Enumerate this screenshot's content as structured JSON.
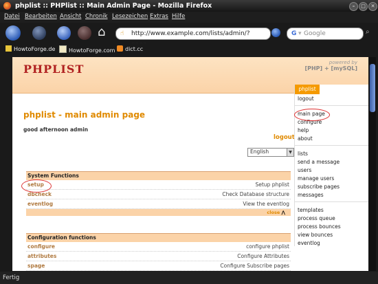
{
  "window": {
    "title": "phplist :: PHPlist :: Main Admin Page - Mozilla Firefox",
    "min": "–",
    "max": "□",
    "close": "✕"
  },
  "menubar": [
    "Datei",
    "Bearbeiten",
    "Ansicht",
    "Chronik",
    "Lesezeichen",
    "Extras",
    "Hilfe"
  ],
  "navbar": {
    "url": "http://www.example.com/lists/admin/?page=",
    "search_placeholder": "Google",
    "search_engine": "G"
  },
  "bookmarks": [
    "HowtoForge.de",
    "HowtoForge.com",
    "dict.cc"
  ],
  "status": "Fertig",
  "page": {
    "logo": "PHPLIST",
    "powered_by": "powered by",
    "powered_tech": "[PHP] + [mySQL]",
    "title": "phplist - main admin page",
    "greeting": "good afternoon admin",
    "logout_link": "logout",
    "language": "English",
    "system_functions": {
      "heading": "System Functions",
      "rows": [
        {
          "name": "setup",
          "desc": "Setup phplist"
        },
        {
          "name": "dbcheck",
          "desc": "Check Database structure"
        },
        {
          "name": "eventlog",
          "desc": "View the eventlog"
        }
      ],
      "close": "close"
    },
    "configuration_functions": {
      "heading": "Configuration functions",
      "rows": [
        {
          "name": "configure",
          "desc": "configure phplist"
        },
        {
          "name": "attributes",
          "desc": "Configure Attributes"
        },
        {
          "name": "spage",
          "desc": "Configure Subscribe pages"
        }
      ]
    },
    "menu": {
      "header": "phplist",
      "logout": "logout",
      "group1": [
        "main page",
        "configure",
        "help",
        "about"
      ],
      "group2": [
        "lists",
        "send a message",
        "users",
        "manage users",
        "subscribe pages",
        "messages"
      ],
      "group3": [
        "templates",
        "process queue",
        "process bounces",
        "view bounces",
        "eventlog"
      ]
    }
  }
}
